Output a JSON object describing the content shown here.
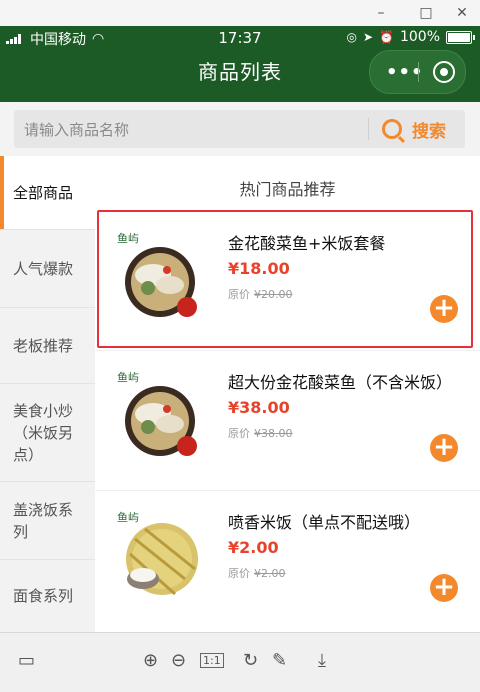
{
  "window": {
    "minimize": "–",
    "maximize": "□",
    "close": "✕"
  },
  "status": {
    "carrier": "中国移动",
    "time": "17:37",
    "battery": "100%"
  },
  "header": {
    "title": "商品列表",
    "more_label": "•••"
  },
  "search": {
    "placeholder": "请输入商品名称",
    "button_label": "搜索"
  },
  "sidebar": {
    "items": [
      {
        "label": "全部商品"
      },
      {
        "label": "人气爆款"
      },
      {
        "label": "老板推荐"
      },
      {
        "label": "美食小炒（米饭另点）"
      },
      {
        "label": "盖浇饭系列"
      },
      {
        "label": "面食系列"
      }
    ]
  },
  "main": {
    "section_title": "热门商品推荐",
    "products": [
      {
        "name": "金花酸菜鱼+米饭套餐",
        "price": "¥18.00",
        "orig_label": "原价",
        "orig_price": "¥20.00",
        "brand": "鱼屿"
      },
      {
        "name": "超大份金花酸菜鱼（不含米饭）",
        "price": "¥38.00",
        "orig_label": "原价",
        "orig_price": "¥38.00",
        "brand": "鱼屿"
      },
      {
        "name": "喷香米饭（单点不配送哦）",
        "price": "¥2.00",
        "orig_label": "原价",
        "orig_price": "¥2.00",
        "brand": "鱼屿"
      }
    ]
  },
  "colors": {
    "header_bg": "#1d5b26",
    "accent": "#f3892c",
    "price": "#e8432a",
    "highlight": "#e8303a"
  }
}
